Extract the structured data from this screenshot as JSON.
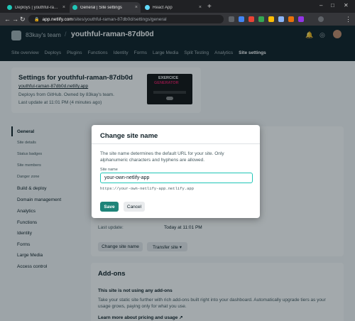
{
  "browser": {
    "tabs": [
      {
        "title": "Deploys | youthful-raman-87db0d",
        "icon": "netlify-icon"
      },
      {
        "title": "General | Site settings",
        "icon": "netlify-icon"
      },
      {
        "title": "React App",
        "icon": "react-icon"
      }
    ],
    "new_tab": "+",
    "url_host": "app.netlify.com",
    "url_path": "/sites/youthful-raman-87db0d/settings/general"
  },
  "header": {
    "team": "83kay's team",
    "site": "youthful-raman-87db0d",
    "nav": [
      "Site overview",
      "Deploys",
      "Plugins",
      "Functions",
      "Identity",
      "Forms",
      "Large Media",
      "Split Testing",
      "Analytics",
      "Site settings"
    ],
    "active_nav": "Site settings"
  },
  "site_card": {
    "title": "Settings for youthful-raman-87db0d",
    "url": "youthful-raman-87db0d.netlify.app",
    "deploys_from": "Deploys from GitHub. Owned by 83kay's team.",
    "last_update": "Last update at 11:01 PM (4 minutes ago)",
    "preview_title_1": "EXERCICE",
    "preview_title_2": "GENERATOR"
  },
  "sidebar": {
    "items": [
      "General",
      "Build & deploy",
      "Domain management",
      "Analytics",
      "Functions",
      "Identity",
      "Forms",
      "Large Media",
      "Access control"
    ],
    "sub_items": [
      "Site details",
      "Status badges",
      "Site members",
      "Danger zone"
    ]
  },
  "site_details": {
    "last_update_label": "Last update:",
    "last_update_value": "Today at 11:01 PM",
    "change_site_name_button": "Change site name",
    "transfer_site_button": "Transfer site ▾"
  },
  "addons": {
    "title": "Add-ons",
    "subtitle": "This site is not using any add-ons",
    "description": "Take your static site further with rich add-ons built right into your dashboard. Automatically upgrade tiers as your usage grows, paying only for what you use.",
    "link": "Learn more about pricing and usage ↗"
  },
  "modal": {
    "title": "Change site name",
    "description": "The site name determines the default URL for your site. Only alphanumeric characters and hyphens are allowed.",
    "field_label": "Site name",
    "field_value": "your-own-netlify-app",
    "url_hint": "https://your-own-netlify-app.netlify.app",
    "save_label": "Save",
    "cancel_label": "Cancel"
  },
  "colors": {
    "accent": "#20c6b7",
    "save": "#1e8479",
    "header_bg": "#0e1e25"
  }
}
